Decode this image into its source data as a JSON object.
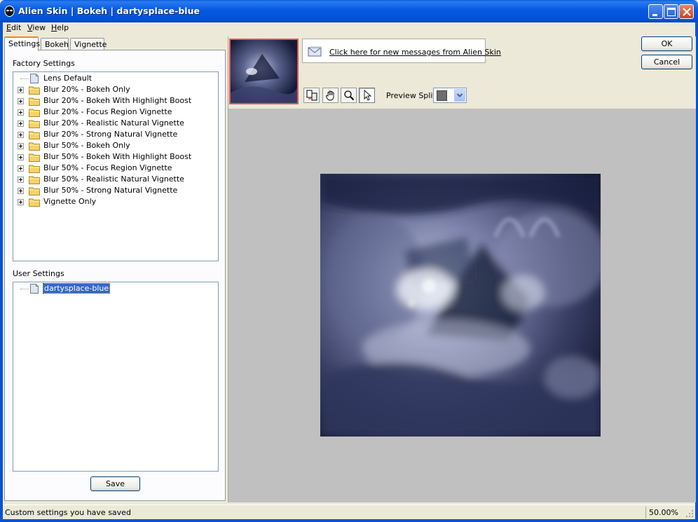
{
  "window": {
    "title": "Alien Skin  |  Bokeh  |  dartysplace-blue",
    "accent_color": "#0453d6"
  },
  "menu": [
    {
      "label": "Edit"
    },
    {
      "label": "View"
    },
    {
      "label": "Help"
    }
  ],
  "tabs": [
    {
      "label": "Settings",
      "active": true
    },
    {
      "label": "Bokeh",
      "active": false
    },
    {
      "label": "Vignette",
      "active": false
    }
  ],
  "factory_settings": {
    "label": "Factory Settings",
    "items": [
      {
        "label": "Lens Default",
        "icon": "document-icon",
        "expandable": false
      },
      {
        "label": "Blur 20% - Bokeh Only",
        "icon": "folder-icon",
        "expandable": true
      },
      {
        "label": "Blur 20% - Bokeh With Highlight Boost",
        "icon": "folder-icon",
        "expandable": true
      },
      {
        "label": "Blur 20% - Focus Region Vignette",
        "icon": "folder-icon",
        "expandable": true
      },
      {
        "label": "Blur 20% - Realistic Natural Vignette",
        "icon": "folder-icon",
        "expandable": true
      },
      {
        "label": "Blur 20% - Strong Natural Vignette",
        "icon": "folder-icon",
        "expandable": true
      },
      {
        "label": "Blur 50% - Bokeh Only",
        "icon": "folder-icon",
        "expandable": true
      },
      {
        "label": "Blur 50% - Bokeh With Highlight Boost",
        "icon": "folder-icon",
        "expandable": true
      },
      {
        "label": "Blur 50% - Focus Region Vignette",
        "icon": "folder-icon",
        "expandable": true
      },
      {
        "label": "Blur 50% - Realistic Natural Vignette",
        "icon": "folder-icon",
        "expandable": true
      },
      {
        "label": "Blur 50% - Strong Natural Vignette",
        "icon": "folder-icon",
        "expandable": true
      },
      {
        "label": "Vignette Only",
        "icon": "folder-icon",
        "expandable": true
      }
    ]
  },
  "user_settings": {
    "label": "User Settings",
    "items": [
      {
        "label": "dartysplace-blue",
        "icon": "document-icon",
        "selected": true
      }
    ]
  },
  "save_label": "Save",
  "messages": {
    "link_text": "Click here for new messages from Alien Skin"
  },
  "toolbar": {
    "tools": [
      {
        "name": "compare-tool",
        "icon": "compare-icon"
      },
      {
        "name": "hand-tool",
        "icon": "hand-icon"
      },
      {
        "name": "zoom-tool",
        "icon": "magnifier-icon"
      },
      {
        "name": "pointer-tool",
        "icon": "arrow-pointer-icon",
        "active": true
      }
    ],
    "preview_split_label": "Preview Split:",
    "preview_split_value_color": "#6e6e70"
  },
  "buttons": {
    "ok": "OK",
    "cancel": "Cancel"
  },
  "status": {
    "text": "Custom settings you have saved",
    "zoom": "50.00%"
  }
}
